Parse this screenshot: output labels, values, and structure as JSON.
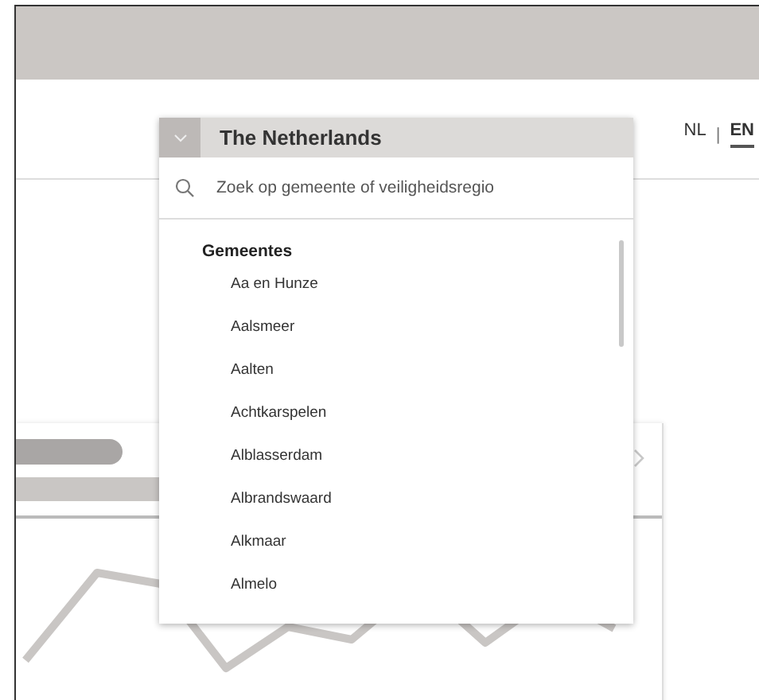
{
  "region_select": {
    "value": "The Netherlands",
    "search": {
      "placeholder": "Zoek op gemeente of veiligheidsregio"
    },
    "group_heading": "Gemeentes",
    "items": [
      {
        "label": "Aa en Hunze"
      },
      {
        "label": "Aalsmeer"
      },
      {
        "label": "Aalten"
      },
      {
        "label": "Achtkarspelen"
      },
      {
        "label": "Alblasserdam"
      },
      {
        "label": "Albrandswaard"
      },
      {
        "label": "Alkmaar"
      },
      {
        "label": "Almelo"
      }
    ]
  },
  "language_switch": {
    "separator": "|",
    "languages": [
      {
        "label": "NL",
        "selected": false
      },
      {
        "label": "EN",
        "selected": true
      }
    ]
  }
}
